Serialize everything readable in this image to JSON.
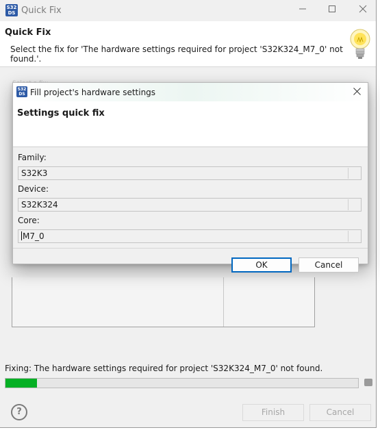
{
  "window": {
    "title": "Quick Fix",
    "header_title": "Quick Fix",
    "header_message": "Select the fix for 'The hardware settings required for project 'S32K324_M7_0' not found.'.",
    "ghost_label": "Select a fix:",
    "fixing_text": "Fixing: The hardware settings required for project 'S32K324_M7_0' not found.",
    "progress": 0.09,
    "finish_label": "Finish",
    "cancel_label": "Cancel",
    "help_glyph": "?"
  },
  "app_icon": {
    "line1": "S32",
    "line2": "DS"
  },
  "dialog": {
    "title": "Fill project's hardware settings",
    "header_title": "Settings quick fix",
    "fields": [
      {
        "label": "Family:",
        "value": "S32K3"
      },
      {
        "label": "Device:",
        "value": "S32K324"
      },
      {
        "label": "Core:",
        "value": "M7_0"
      }
    ],
    "ok_label": "OK",
    "cancel_label": "Cancel"
  },
  "colors": {
    "progress_fill": "#06b025",
    "default_button_border": "#0067c0"
  },
  "icons": {
    "minimize": "minimize-icon",
    "maximize": "maximize-icon",
    "close": "close-icon",
    "lightbulb": "lightbulb-icon",
    "help": "help-icon",
    "stop": "stop-icon"
  }
}
